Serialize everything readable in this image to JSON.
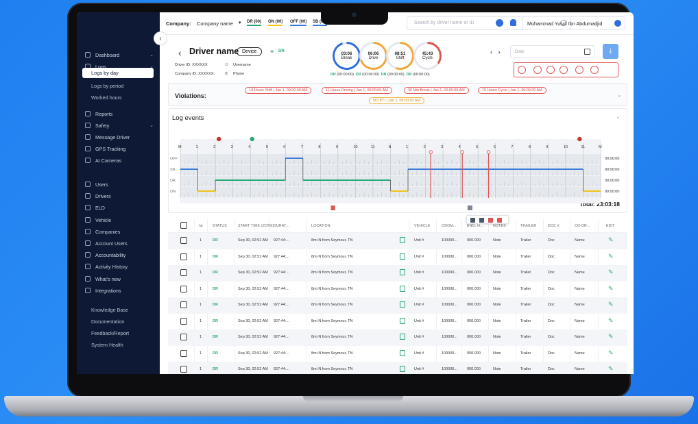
{
  "company": {
    "label": "Company:",
    "name": "Company name"
  },
  "duty_tabs": [
    {
      "label": "DR (00)",
      "color": "#2aa876"
    },
    {
      "label": "ON (00)",
      "color": "#f0c419"
    },
    {
      "label": "OFF (00)",
      "color": "#3b7bd9"
    },
    {
      "label": "SB (00)",
      "color": "#3b7bd9"
    }
  ],
  "search": {
    "placeholder": "Search by driver name or ID"
  },
  "user": {
    "name": "Muhammad Yusuf Ibn Abdumadjid"
  },
  "sidebar": {
    "items": [
      {
        "label": "Dashboard",
        "chevron": true
      },
      {
        "label": "Logs",
        "chevron": true
      },
      {
        "label": "Reports"
      },
      {
        "label": "Safety",
        "chevron": true
      },
      {
        "label": "Message Driver"
      },
      {
        "label": "GPS Tracking"
      },
      {
        "label": "AI Cameras"
      },
      {
        "label": "Users"
      },
      {
        "label": "Drivers"
      },
      {
        "label": "ELD"
      },
      {
        "label": "Vehicle"
      },
      {
        "label": "Companies"
      },
      {
        "label": "Account Users"
      },
      {
        "label": "Accountability"
      },
      {
        "label": "Activity History"
      },
      {
        "label": "What's new"
      },
      {
        "label": "Integrations"
      }
    ],
    "logs_sub": [
      "Logs by day",
      "Logs by period",
      "Worked hours"
    ],
    "footer": [
      "Knowledge Base",
      "Documentation",
      "Feedback/Report",
      "System Health"
    ]
  },
  "driver": {
    "name": "Driver name",
    "device": "Device",
    "status": "DR",
    "driver_id": "Driver ID: XXXXXX",
    "company_id": "Company ID: XXXXXX",
    "username": "Username",
    "phone": "Phone"
  },
  "gauges": [
    {
      "time": "03:06",
      "label": "Break",
      "color": "#2f6fdc",
      "progress": 0.95
    },
    {
      "time": "06:06",
      "label": "Drive",
      "color": "#f0a63a",
      "progress": 0.7
    },
    {
      "time": "08:51",
      "label": "Shift",
      "color": "#f0a63a",
      "progress": 0.55
    },
    {
      "time": "45:43",
      "label": "Cycle",
      "color": "#e05454",
      "progress": 0.35
    }
  ],
  "gauge_times": "(00:00:00)",
  "date": {
    "placeholder": "Date"
  },
  "violations": {
    "title": "Violations:",
    "items": [
      {
        "text": "14 Hours Shift | Jan 1, 00:00:00 AM",
        "type": "red"
      },
      {
        "text": "11 Hours Driving | Jan 1, 00:00:00 AM",
        "type": "red"
      },
      {
        "text": "30 Min Break | Jan 1, 00:00:00 AM",
        "type": "red"
      },
      {
        "text": "70 Hours Cycle | Jan 1, 00:00:00 AM",
        "type": "red"
      },
      {
        "text": "NO PTI | Jan 1, 00:00:00 AM",
        "type": "orange"
      }
    ]
  },
  "log": {
    "title": "Log events",
    "hours": [
      "M",
      "1",
      "2",
      "3",
      "4",
      "5",
      "6",
      "7",
      "8",
      "9",
      "10",
      "11",
      "N",
      "1",
      "2",
      "3",
      "4",
      "5",
      "6",
      "7",
      "8",
      "9",
      "10",
      "11",
      "M"
    ],
    "rows": [
      "OFF",
      "SB",
      "DR",
      "ON"
    ],
    "row_totals": [
      "00:00:00",
      "00:00:00",
      "00:00:00",
      "00:00:00"
    ],
    "total": "Total: 23:03:18"
  },
  "table": {
    "headers": [
      "№",
      "STATUS",
      "START TIME (ZONE)",
      "DURAT...",
      "LOCATION",
      "VEHICLE",
      "ODOM...",
      "ENG. H...",
      "NOTES",
      "TRAILER",
      "DOC #",
      "CO-DR...",
      "EDIT"
    ],
    "rows": [
      {
        "n": "1",
        "status": "DR",
        "start": "Sep 30, 02:52 AM",
        "dur": "927:44:...",
        "loc": "8mi N from Seymour, TN",
        "veh": "Unit #",
        "odom": "100000...",
        "eng": "000.000",
        "notes": "Note",
        "trailer": "Trailer",
        "doc": "Doc",
        "codr": "Name"
      },
      {
        "n": "1",
        "status": "DR",
        "start": "Sep 30, 02:52 AM",
        "dur": "927:44:...",
        "loc": "8mi N from Seymour, TN",
        "veh": "Unit #",
        "odom": "100000...",
        "eng": "000.000",
        "notes": "Note",
        "trailer": "Trailer",
        "doc": "Doc",
        "codr": "Name"
      },
      {
        "n": "1",
        "status": "DR",
        "start": "Sep 30, 02:52 AM",
        "dur": "927:44:...",
        "loc": "8mi N from Seymour, TN",
        "veh": "Unit #",
        "odom": "100000...",
        "eng": "000.000",
        "notes": "Note",
        "trailer": "Trailer",
        "doc": "Doc",
        "codr": "Name"
      },
      {
        "n": "1",
        "status": "DR",
        "start": "Sep 30, 02:52 AM",
        "dur": "927:44:...",
        "loc": "8mi N from Seymour, TN",
        "veh": "Unit #",
        "odom": "100000...",
        "eng": "000.000",
        "notes": "Note",
        "trailer": "Trailer",
        "doc": "Doc",
        "codr": "Name"
      },
      {
        "n": "1",
        "status": "DR",
        "start": "Sep 30, 02:52 AM",
        "dur": "927:44:...",
        "loc": "8mi N from Seymour, TN",
        "veh": "Unit #",
        "odom": "100000...",
        "eng": "000.000",
        "notes": "Note",
        "trailer": "Trailer",
        "doc": "Doc",
        "codr": "Name"
      },
      {
        "n": "1",
        "status": "DR",
        "start": "Sep 30, 02:52 AM",
        "dur": "927:44:...",
        "loc": "8mi N from Seymour, TN",
        "veh": "Unit #",
        "odom": "100000...",
        "eng": "000.000",
        "notes": "Note",
        "trailer": "Trailer",
        "doc": "Doc",
        "codr": "Name"
      },
      {
        "n": "1",
        "status": "DR",
        "start": "Sep 30, 02:52 AM",
        "dur": "927:44:...",
        "loc": "8mi N from Seymour, TN",
        "veh": "Unit #",
        "odom": "100000...",
        "eng": "000.000",
        "notes": "Note",
        "trailer": "Trailer",
        "doc": "Doc",
        "codr": "Name"
      },
      {
        "n": "1",
        "status": "DR",
        "start": "Sep 30, 02:52 AM",
        "dur": "927:44:...",
        "loc": "8mi N from Seymour, TN",
        "veh": "Unit #",
        "odom": "100000...",
        "eng": "000.000",
        "notes": "Note",
        "trailer": "Trailer",
        "doc": "Doc",
        "codr": "Name"
      },
      {
        "n": "1",
        "status": "DR",
        "start": "Sep 30, 02:52 AM",
        "dur": "927:44:...",
        "loc": "8mi N from Seymour, TN",
        "veh": "Unit #",
        "odom": "100000...",
        "eng": "000.000",
        "notes": "Note",
        "trailer": "Trailer",
        "doc": "Doc",
        "codr": "Name"
      }
    ]
  },
  "colors": {
    "sidebar": "#0e1a35",
    "accent": "#2f6fdc",
    "driving": "#2aa876",
    "violation": "#e05454",
    "on_duty": "#f0c419"
  }
}
